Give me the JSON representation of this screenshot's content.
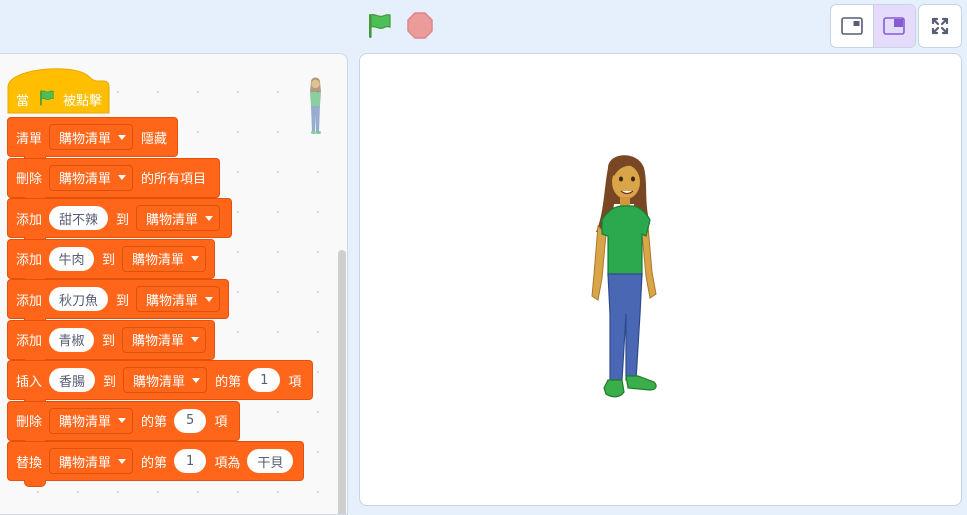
{
  "colors": {
    "motion_orange": "#ff6619",
    "event_yellow": "#ffbf00",
    "flag_green": "#3ea943",
    "stop_red": "#ec5959",
    "workspace_bg": "#e6f0fd"
  },
  "topbar": {
    "green_flag_icon": "green-flag-icon",
    "stop_icon": "stop-sign-icon",
    "small_stage_icon": "small-stage-icon",
    "normal_stage_icon": "normal-stage-icon",
    "fullscreen_icon": "fullscreen-icon"
  },
  "script": {
    "hat": {
      "when": "當",
      "clicked": "被點擊"
    },
    "blocks": [
      {
        "parts": [
          {
            "t": "text",
            "v": "清單"
          },
          {
            "t": "dropdown",
            "v": "購物清單"
          },
          {
            "t": "text",
            "v": "隱藏"
          }
        ]
      },
      {
        "parts": [
          {
            "t": "text",
            "v": "刪除"
          },
          {
            "t": "dropdown",
            "v": "購物清單"
          },
          {
            "t": "text",
            "v": "的所有項目"
          }
        ]
      },
      {
        "parts": [
          {
            "t": "text",
            "v": "添加"
          },
          {
            "t": "input",
            "v": "甜不辣"
          },
          {
            "t": "text",
            "v": "到"
          },
          {
            "t": "dropdown",
            "v": "購物清單"
          }
        ]
      },
      {
        "parts": [
          {
            "t": "text",
            "v": "添加"
          },
          {
            "t": "input",
            "v": "牛肉"
          },
          {
            "t": "text",
            "v": "到"
          },
          {
            "t": "dropdown",
            "v": "購物清單"
          }
        ]
      },
      {
        "parts": [
          {
            "t": "text",
            "v": "添加"
          },
          {
            "t": "input",
            "v": "秋刀魚"
          },
          {
            "t": "text",
            "v": "到"
          },
          {
            "t": "dropdown",
            "v": "購物清單"
          }
        ]
      },
      {
        "parts": [
          {
            "t": "text",
            "v": "添加"
          },
          {
            "t": "input",
            "v": "青椒"
          },
          {
            "t": "text",
            "v": "到"
          },
          {
            "t": "dropdown",
            "v": "購物清單"
          }
        ]
      },
      {
        "parts": [
          {
            "t": "text",
            "v": "插入"
          },
          {
            "t": "input",
            "v": "香腸"
          },
          {
            "t": "text",
            "v": "到"
          },
          {
            "t": "dropdown",
            "v": "購物清單"
          },
          {
            "t": "text",
            "v": "的第"
          },
          {
            "t": "number",
            "v": "1"
          },
          {
            "t": "text",
            "v": "項"
          }
        ]
      },
      {
        "parts": [
          {
            "t": "text",
            "v": "刪除"
          },
          {
            "t": "dropdown",
            "v": "購物清單"
          },
          {
            "t": "text",
            "v": "的第"
          },
          {
            "t": "number",
            "v": "5"
          },
          {
            "t": "text",
            "v": "項"
          }
        ]
      },
      {
        "parts": [
          {
            "t": "text",
            "v": "替換"
          },
          {
            "t": "dropdown",
            "v": "購物清單"
          },
          {
            "t": "text",
            "v": "的第"
          },
          {
            "t": "number",
            "v": "1"
          },
          {
            "t": "text",
            "v": "項為"
          },
          {
            "t": "input",
            "v": "干貝"
          }
        ]
      }
    ]
  }
}
